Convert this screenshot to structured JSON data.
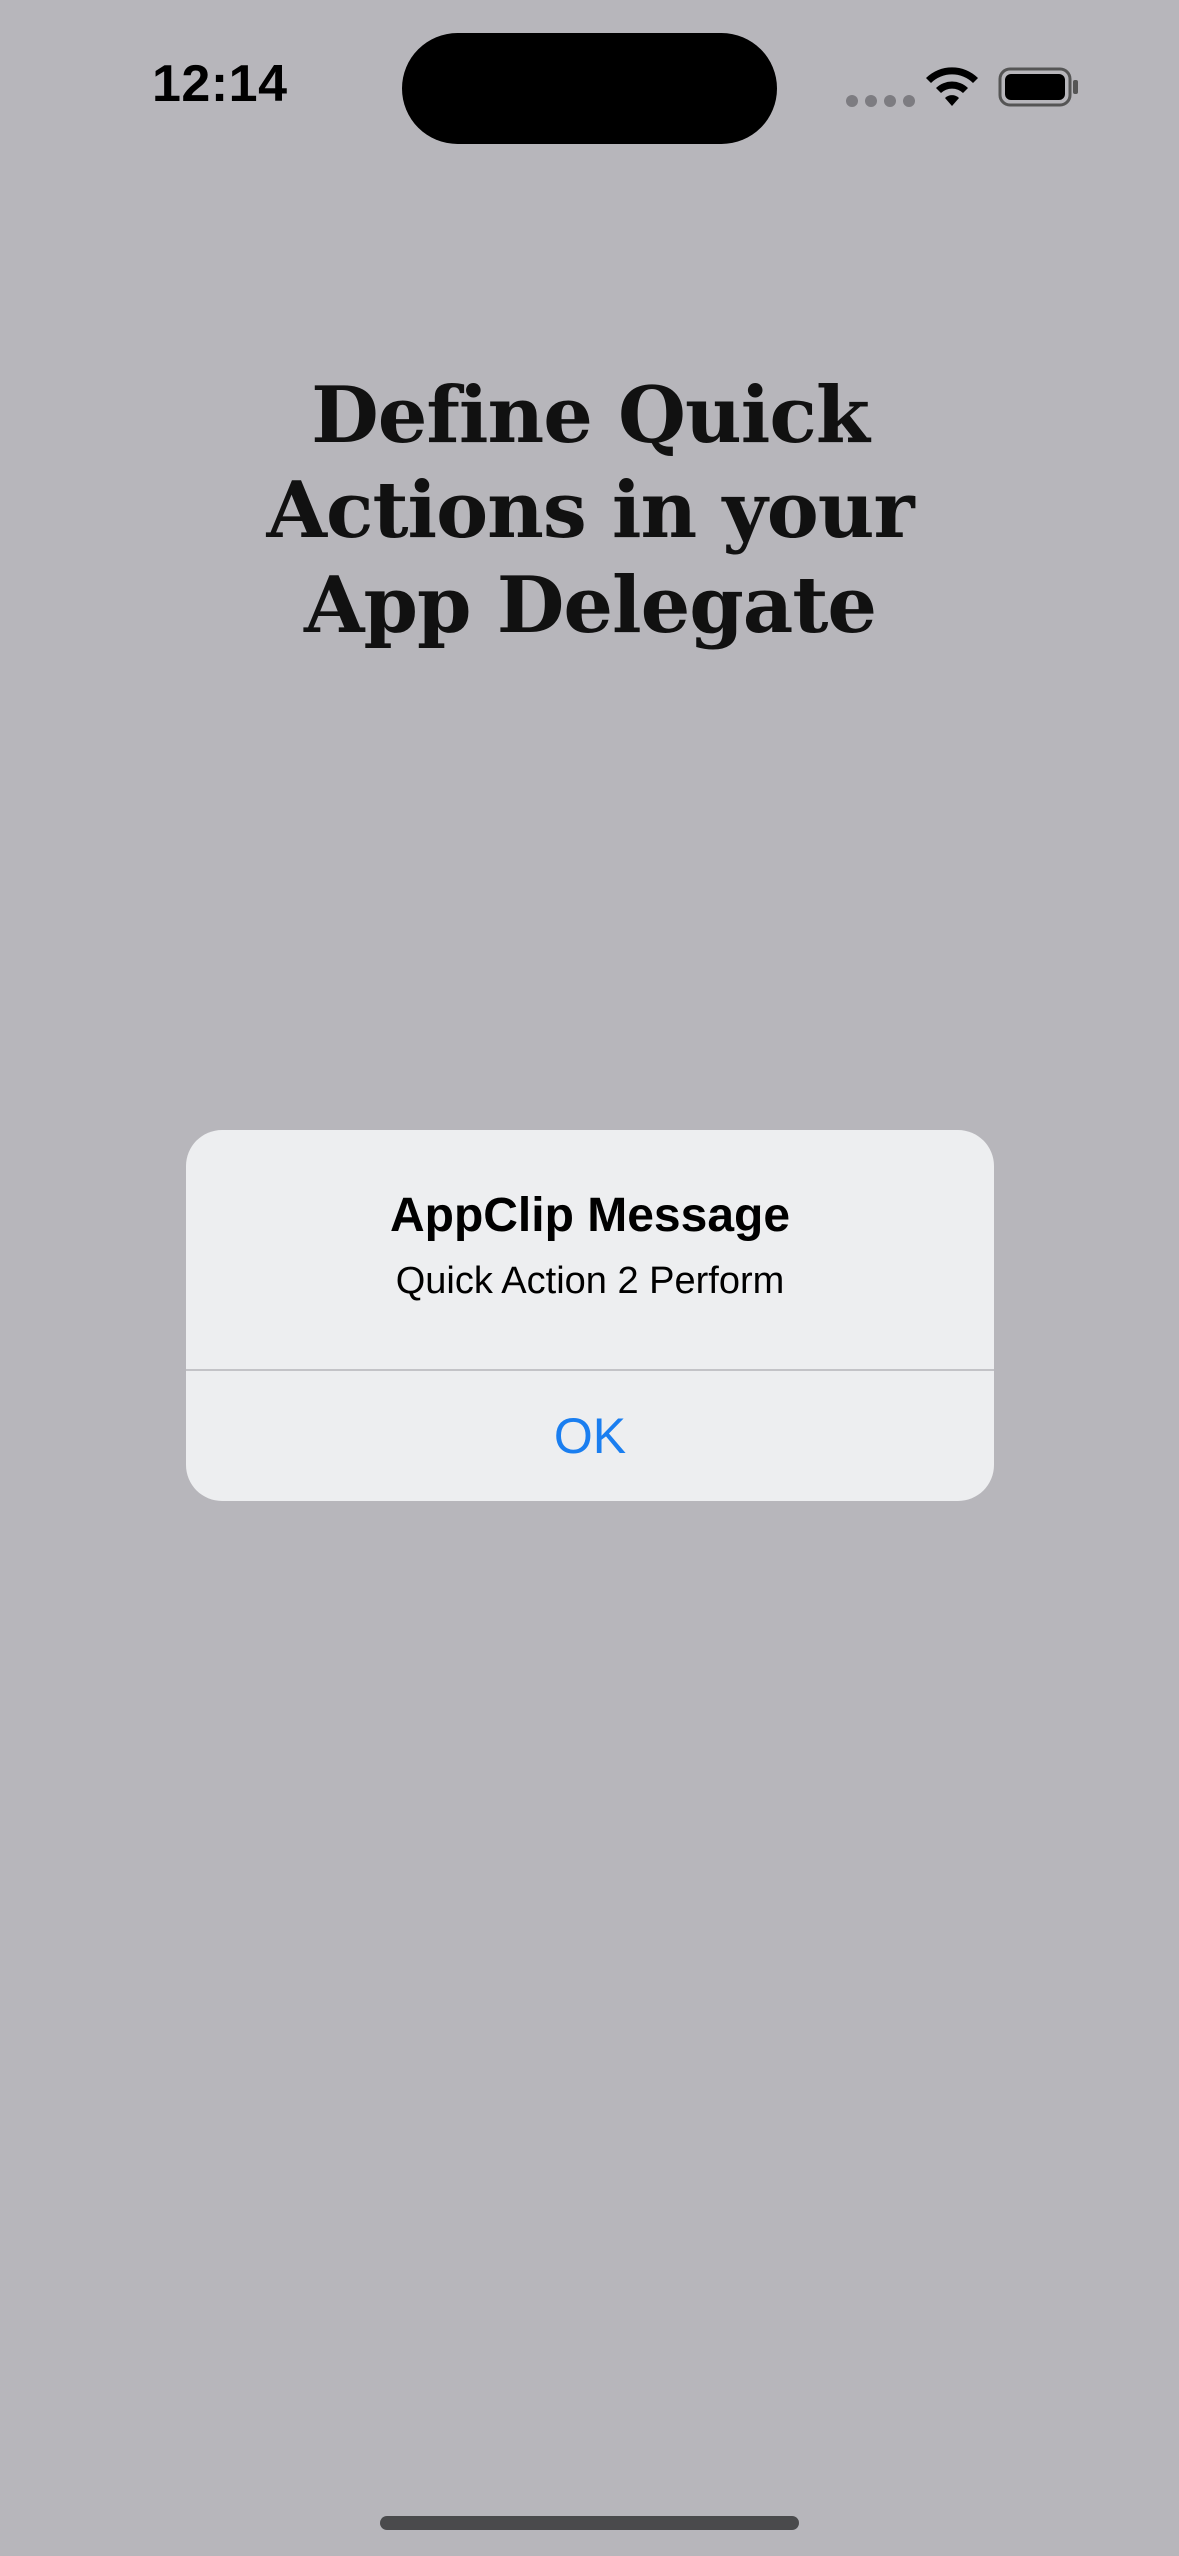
{
  "status_bar": {
    "time": "12:14"
  },
  "content": {
    "headline": "Define Quick Actions in your App Delegate"
  },
  "alert": {
    "title": "AppClip Message",
    "message": "Quick Action 2 Perform",
    "ok_label": "OK"
  },
  "icons": {
    "signal": "cellular-signal-icon",
    "wifi": "wifi-icon",
    "battery": "battery-icon"
  },
  "colors": {
    "background": "#b7b6bb",
    "alert_background": "#edeef0",
    "accent": "#1a7ef0"
  }
}
